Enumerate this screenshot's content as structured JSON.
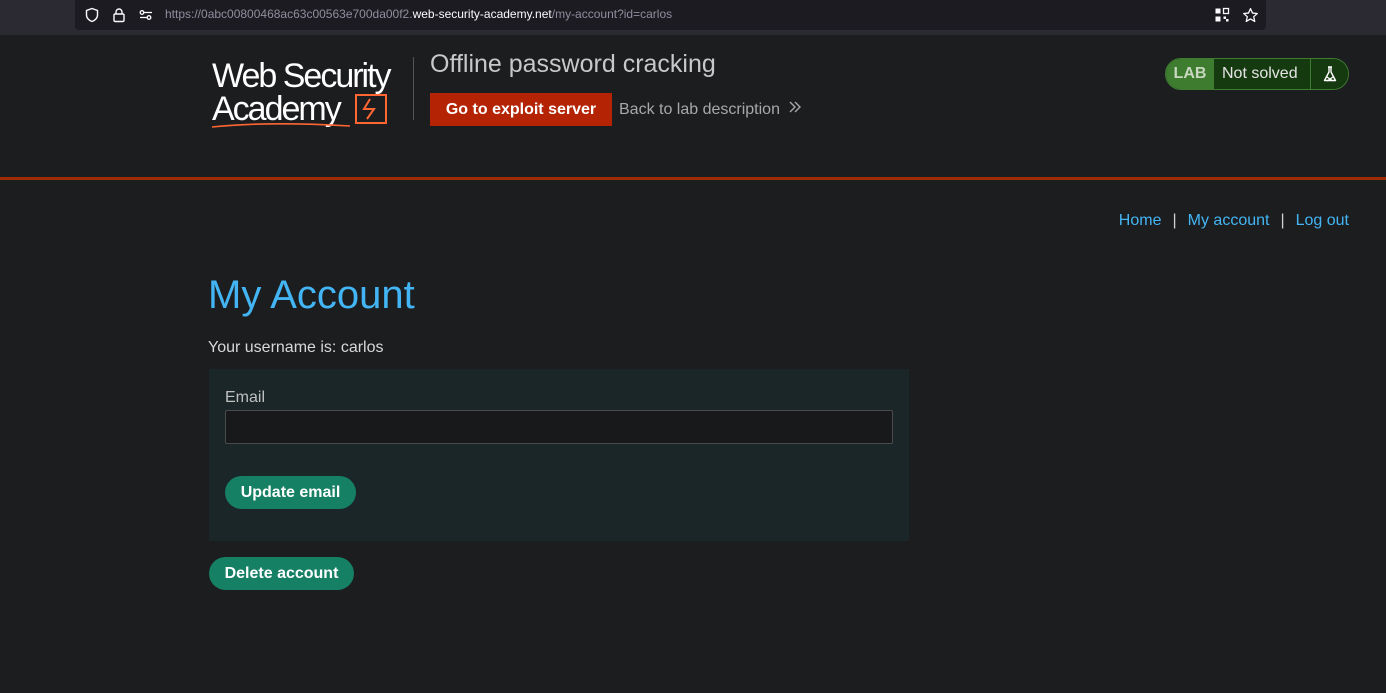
{
  "browser": {
    "url_prefix": "https://0abc00800468ac63c00563e700da00f2.",
    "url_domain": "web-security-academy.net",
    "url_path": "/my-account?id=carlos"
  },
  "header": {
    "logo_line1": "Web Security",
    "logo_line2": "Academy",
    "lab_title": "Offline password cracking",
    "exploit_button": "Go to exploit server",
    "back_link": "Back to lab description",
    "lab_badge": "LAB",
    "lab_status": "Not solved"
  },
  "nav": {
    "home": "Home",
    "my_account": "My account",
    "log_out": "Log out",
    "separator": "|"
  },
  "main": {
    "title": "My Account",
    "username_line": "Your username is: carlos",
    "email_label": "Email",
    "email_value": "",
    "update_button": "Update email",
    "delete_button": "Delete account"
  },
  "colors": {
    "accent_blue": "#43b5f4",
    "exploit_red": "#b42404",
    "button_green": "#168064",
    "lab_green": "#3e7c30"
  }
}
